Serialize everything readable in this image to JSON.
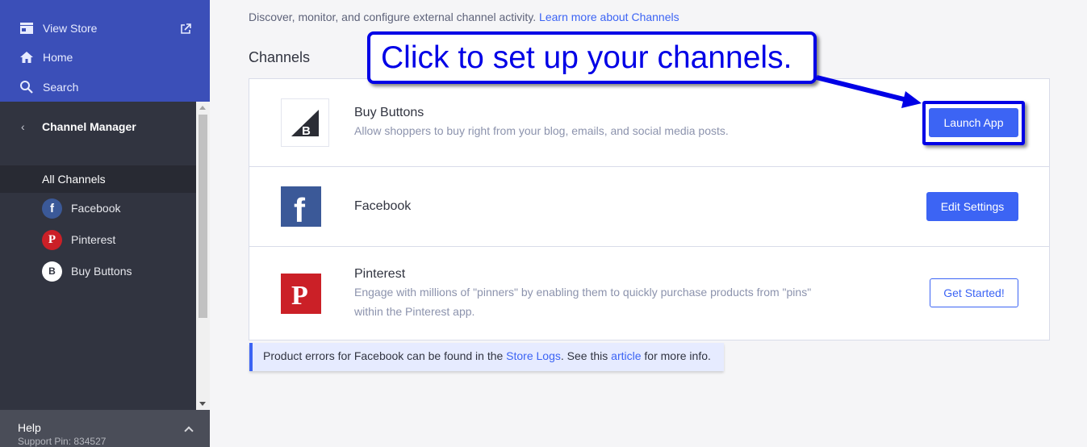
{
  "sidebar": {
    "top_items": [
      {
        "label": "View Store",
        "icon": "store-icon"
      },
      {
        "label": "Home",
        "icon": "home-icon"
      },
      {
        "label": "Search",
        "icon": "search-icon"
      }
    ],
    "section_title": "Channel Manager",
    "back_glyph": "‹",
    "active_item": "All Channels",
    "channels": [
      {
        "label": "Facebook",
        "icon": "facebook-icon",
        "color": "#3b5998",
        "glyph": "f"
      },
      {
        "label": "Pinterest",
        "icon": "pinterest-icon",
        "color": "#cb2027",
        "glyph": "P"
      },
      {
        "label": "Buy Buttons",
        "icon": "buy-buttons-icon",
        "color": "#ffffff",
        "glyph": "B"
      }
    ],
    "help_label": "Help",
    "support_pin": "Support Pin: 834527"
  },
  "main": {
    "description": "Discover, monitor, and configure external channel activity.",
    "learn_more_link": "Learn more about Channels",
    "section_title": "Channels",
    "rows": [
      {
        "name": "Buy Buttons",
        "desc": "Allow shoppers to buy right from your blog, emails, and social media posts.",
        "button": "Launch App",
        "button_style": "primary",
        "logo": "bigcommerce-logo"
      },
      {
        "name": "Facebook",
        "desc": "",
        "button": "Edit Settings",
        "button_style": "primary",
        "logo": "facebook-logo"
      },
      {
        "name": "Pinterest",
        "desc": "Engage with millions of \"pinners\" by enabling them to quickly purchase products from \"pins\" within the Pinterest app.",
        "button": "Get Started!",
        "button_style": "outline",
        "logo": "pinterest-logo"
      }
    ],
    "notice": {
      "prefix": "Product errors for Facebook can be found in the",
      "link1": "Store Logs",
      "middle": ". See this",
      "link2": "article",
      "suffix": "for more info."
    }
  },
  "annotation": {
    "callout_text": "Click to set up your channels.",
    "color": "#0000e6"
  },
  "colors": {
    "accent": "#3c64f4",
    "sidebar_bg": "#313440",
    "sidebar_top_bg": "#3b4fb8"
  }
}
